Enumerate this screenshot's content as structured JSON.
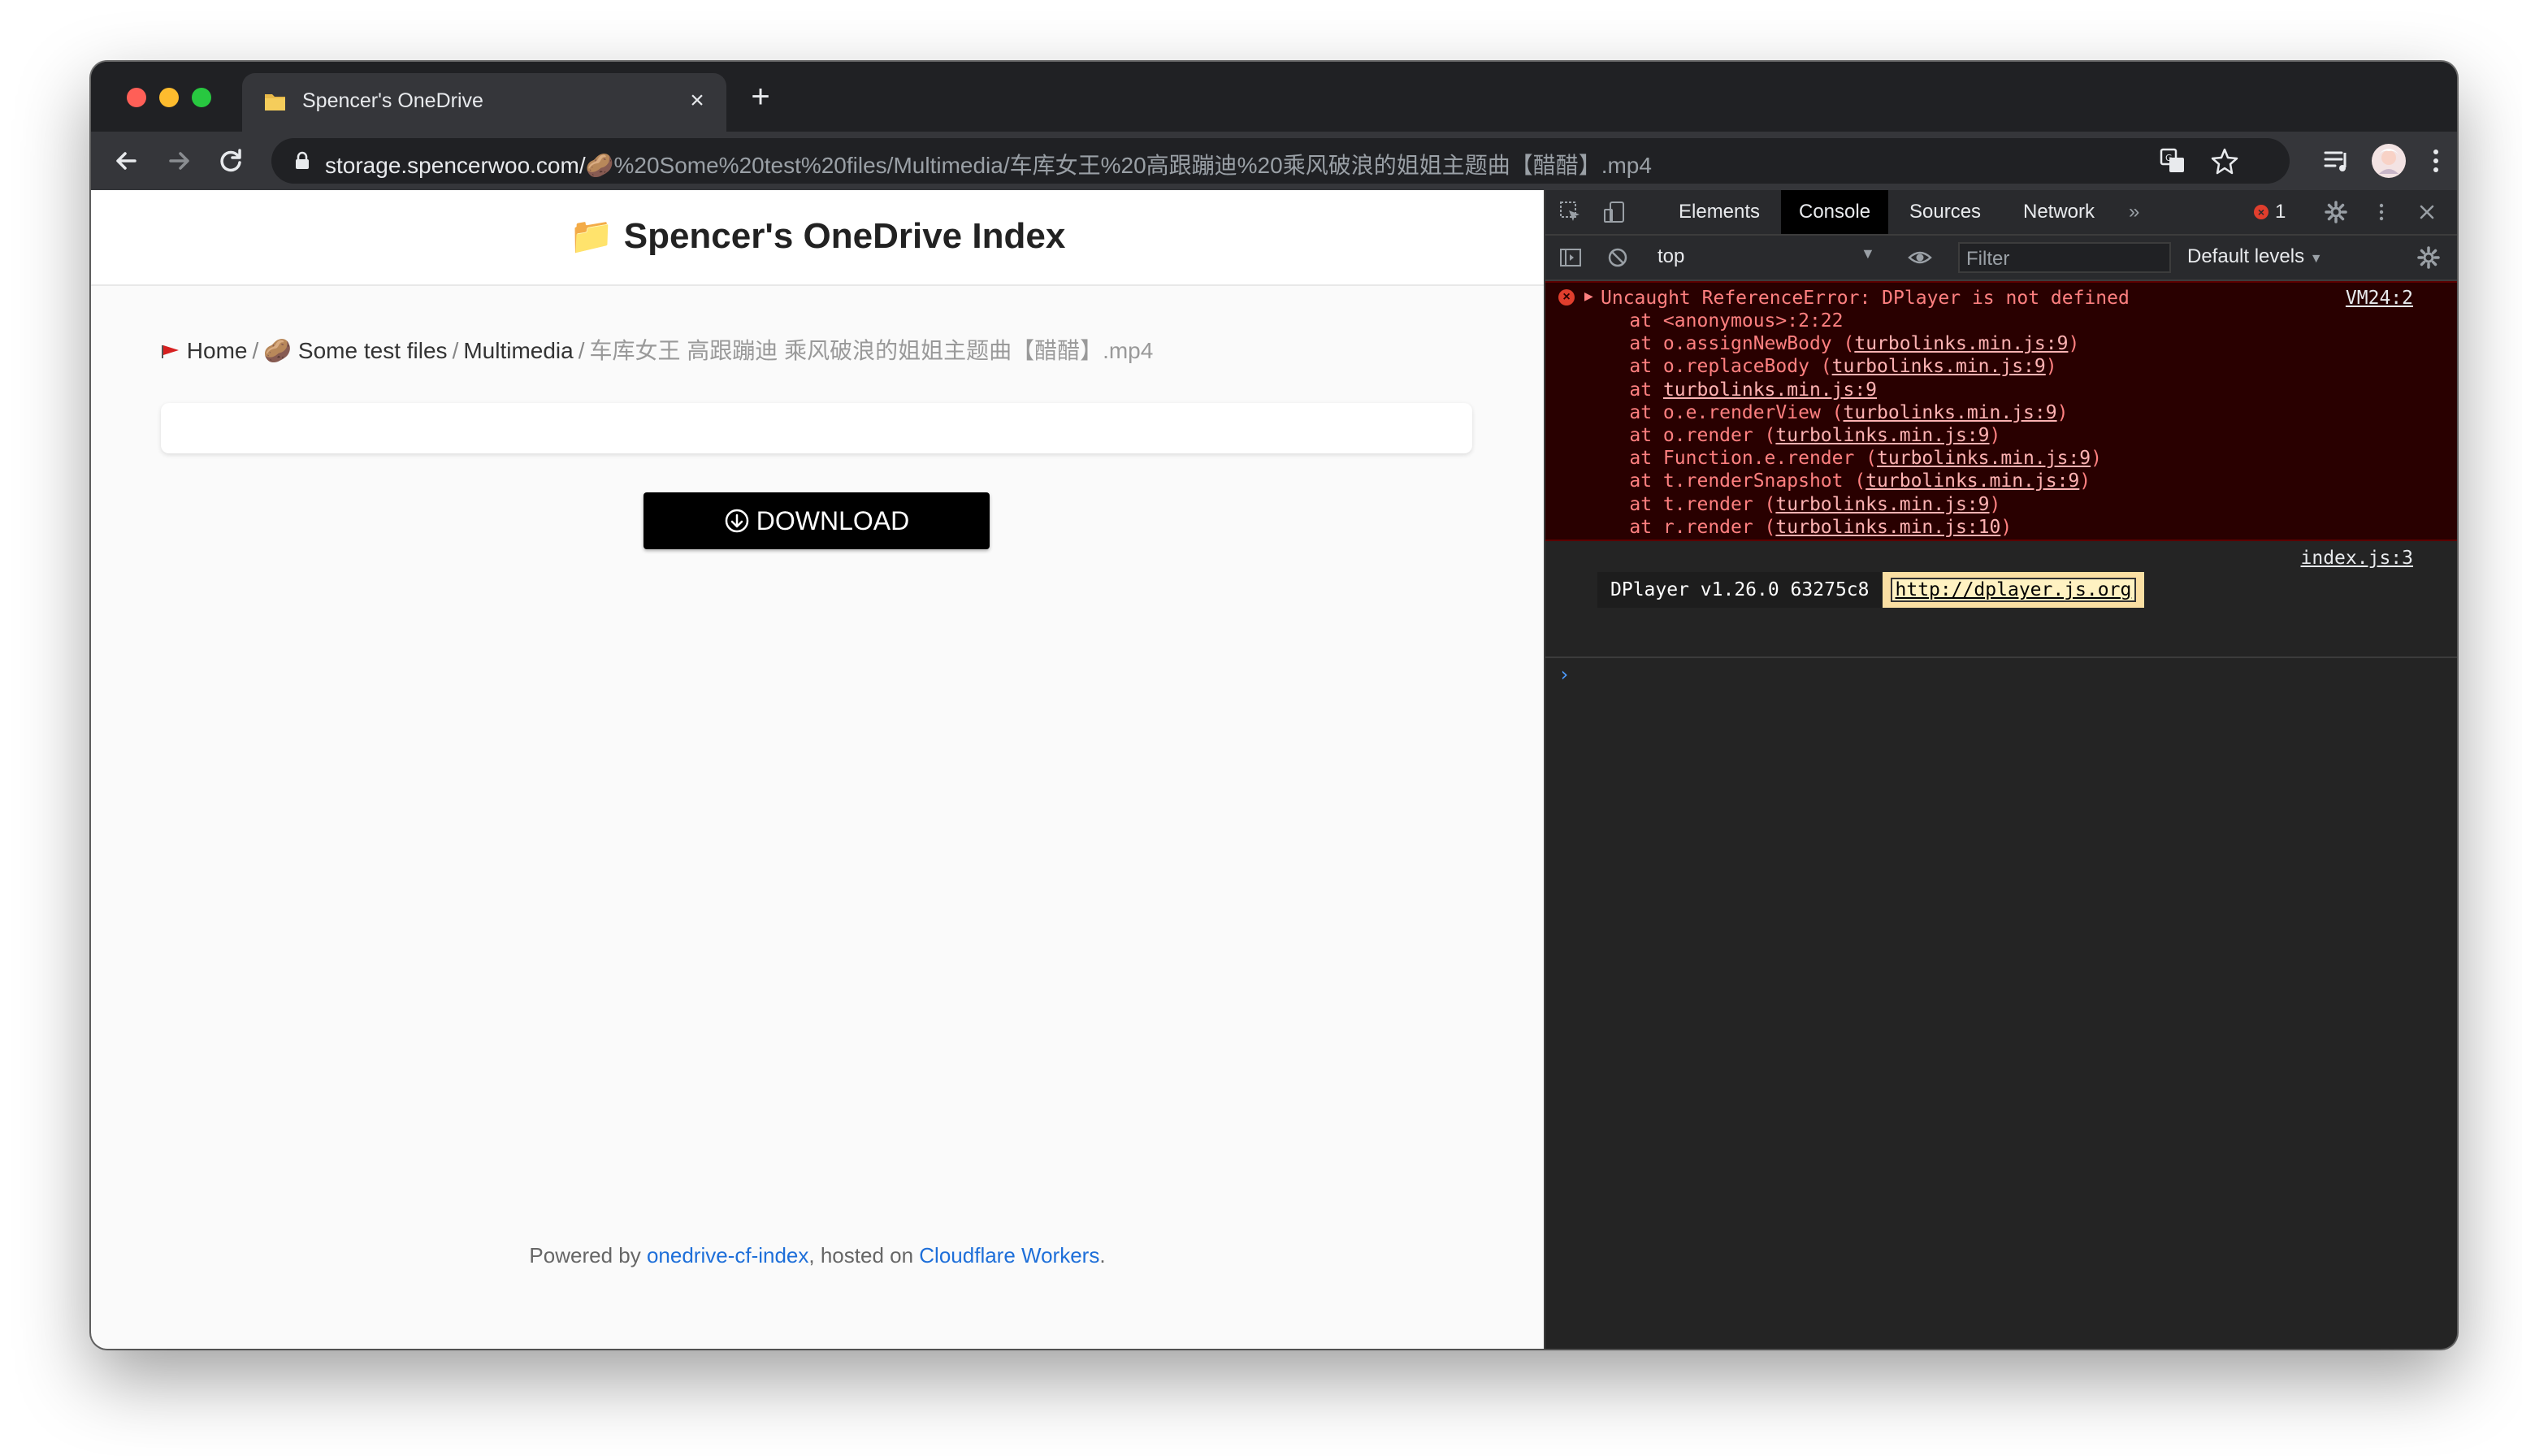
{
  "browser": {
    "tab_title": "Spencer's OneDrive",
    "url_host": "storage.spencerwoo.com/",
    "url_emoji": "🥔",
    "url_path": "%20Some%20test%20files/Multimedia/车库女王%20高跟蹦迪%20乘风破浪的姐姐主题曲【醋醋】.mp4"
  },
  "page": {
    "title": "Spencer's OneDrive Index",
    "title_icon": "📁",
    "breadcrumb": {
      "home": "Home",
      "sep": "/",
      "folder1_emoji": "🥔",
      "folder1": "Some test files",
      "folder2": "Multimedia",
      "current": "车库女王 高跟蹦迪 乘风破浪的姐姐主题曲【醋醋】.mp4"
    },
    "download_label": "DOWNLOAD",
    "footer": {
      "prefix": "Powered by ",
      "link1": "onedrive-cf-index",
      "middle": ", hosted on ",
      "link2": "Cloudflare Workers",
      "suffix": "."
    }
  },
  "devtools": {
    "tabs": [
      "Elements",
      "Console",
      "Sources",
      "Network"
    ],
    "active_tab": "Console",
    "more_tabs": "»",
    "error_count": "1",
    "context": "top",
    "filter_placeholder": "Filter",
    "levels": "Default levels",
    "error": {
      "message": "Uncaught ReferenceError: DPlayer is not defined",
      "source": "VM24:2",
      "stack": [
        {
          "pre": "    at <anonymous>:2:22",
          "link": "",
          "post": ""
        },
        {
          "pre": "    at o.assignNewBody (",
          "link": "turbolinks.min.js:9",
          "post": ")"
        },
        {
          "pre": "    at o.replaceBody (",
          "link": "turbolinks.min.js:9",
          "post": ")"
        },
        {
          "pre": "    at ",
          "link": "turbolinks.min.js:9",
          "post": ""
        },
        {
          "pre": "    at o.e.renderView (",
          "link": "turbolinks.min.js:9",
          "post": ")"
        },
        {
          "pre": "    at o.render (",
          "link": "turbolinks.min.js:9",
          "post": ")"
        },
        {
          "pre": "    at Function.e.render (",
          "link": "turbolinks.min.js:9",
          "post": ")"
        },
        {
          "pre": "    at t.renderSnapshot (",
          "link": "turbolinks.min.js:9",
          "post": ")"
        },
        {
          "pre": "    at t.render (",
          "link": "turbolinks.min.js:9",
          "post": ")"
        },
        {
          "pre": "    at r.render (",
          "link": "turbolinks.min.js:10",
          "post": ")"
        }
      ]
    },
    "log": {
      "source": "index.js:3",
      "version": "DPlayer v1.26.0 63275c8",
      "link": "http://dplayer.js.org"
    },
    "prompt": "›"
  },
  "colors": {
    "window_chrome": "#202124",
    "toolbar": "#35363a",
    "error_bg": "#290000",
    "error_text": "#ff8080",
    "link_blue": "#1e6fd9",
    "download_bg": "#000000"
  }
}
